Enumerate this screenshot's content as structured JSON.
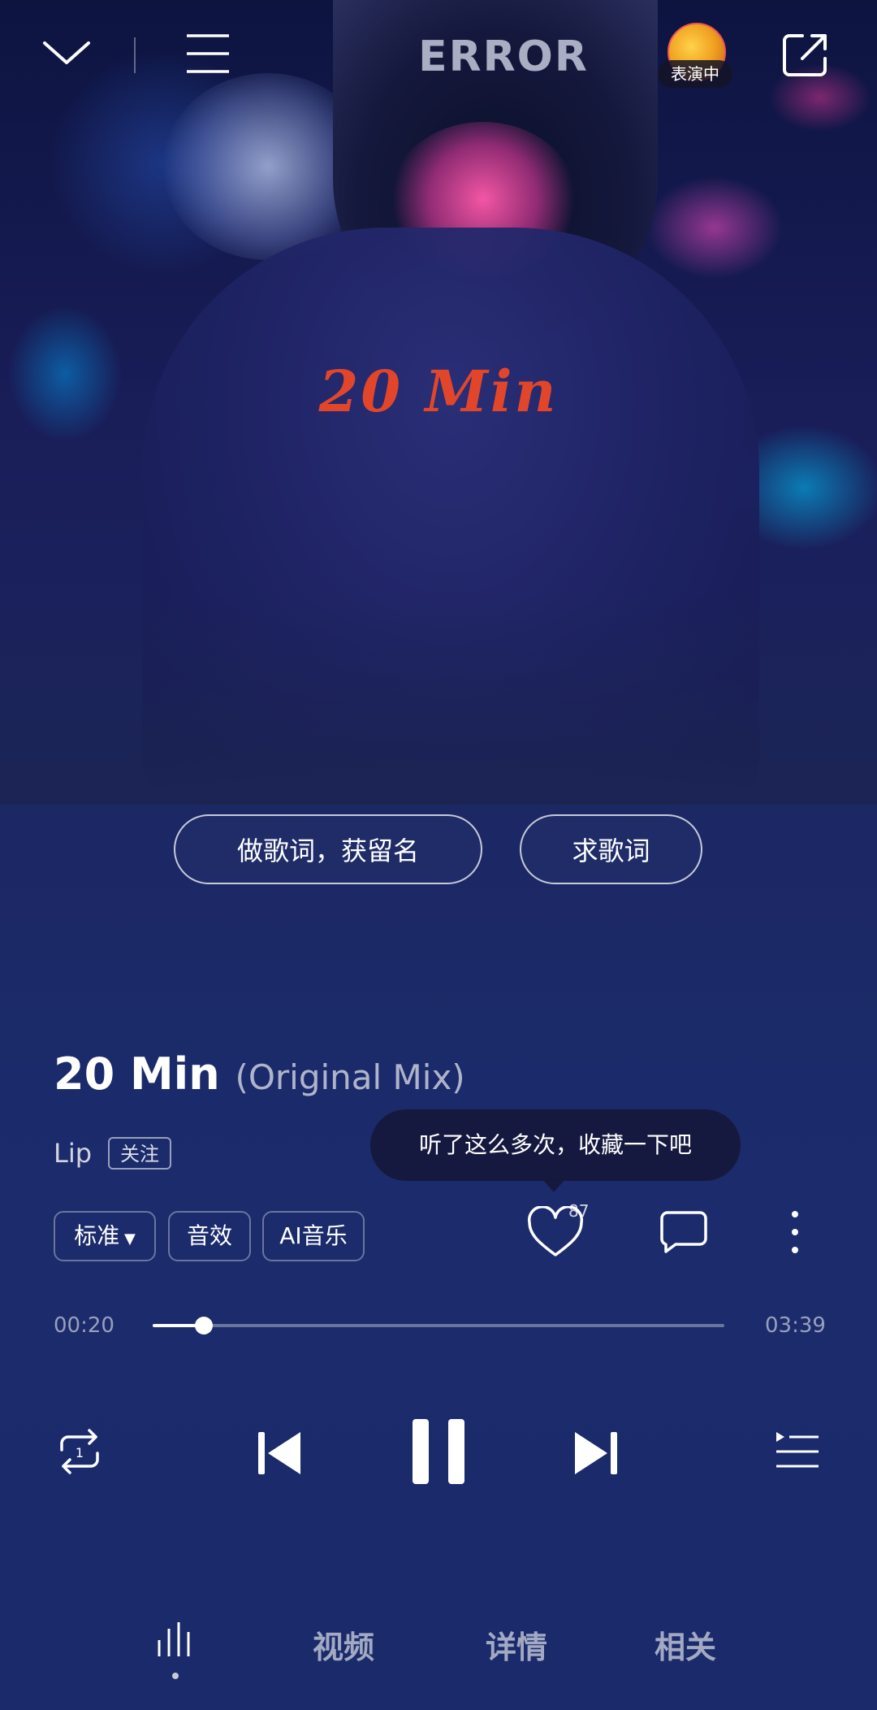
{
  "header": {
    "back_icon": "chevron-down-icon",
    "menu_icon": "menu-icon",
    "avatar_badge": "表演中",
    "share_icon": "share-icon"
  },
  "cover": {
    "title_text": "20 Min",
    "cap_text": "ERROR"
  },
  "lyrics_actions": {
    "make_lyrics": "做歌词，获留名",
    "request_lyrics": "求歌词"
  },
  "song": {
    "title": "20 Min",
    "subtitle": "(Original Mix)",
    "artist": "Lip",
    "follow_label": "关注"
  },
  "tooltip": "听了这么多次，收藏一下吧",
  "options": {
    "quality": "标准",
    "effects": "音效",
    "ai_music": "AI音乐"
  },
  "actions": {
    "like_count": "87",
    "like_icon": "heart-icon",
    "comment_icon": "comment-icon",
    "more_icon": "more-vertical-icon"
  },
  "progress": {
    "current": "00:20",
    "total": "03:39",
    "fraction": 0.09
  },
  "controls": {
    "repeat_icon": "repeat-one-icon",
    "prev_icon": "skip-previous-icon",
    "pause_icon": "pause-icon",
    "next_icon": "skip-next-icon",
    "playlist_icon": "playlist-icon"
  },
  "tabs": {
    "eq_icon": "equalizer-icon",
    "video": "视频",
    "detail": "详情",
    "related": "相关"
  },
  "colors": {
    "cover_title": "#e2462a",
    "background": "#1c2762"
  }
}
